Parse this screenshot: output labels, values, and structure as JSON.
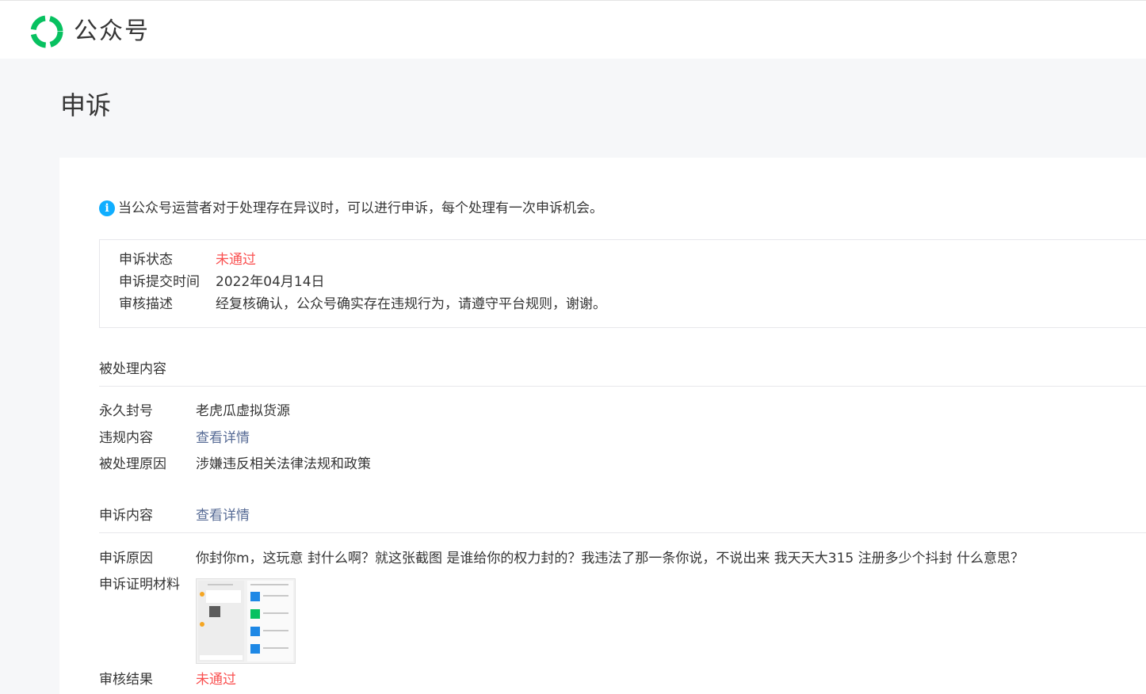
{
  "header": {
    "brand": "公众号",
    "colors": {
      "logo_green": "#07c160",
      "logo_dark_green": "#1aad19"
    }
  },
  "page": {
    "title": "申诉"
  },
  "notice": {
    "icon": "info-icon",
    "text": "当公众号运营者对于处理存在异议时，可以进行申诉，每个处理有一次申诉机会。"
  },
  "status_box": {
    "status_label": "申诉状态",
    "status_value": "未通过",
    "time_label": "申诉提交时间",
    "time_value": "2022年04月14日",
    "desc_label": "审核描述",
    "desc_value": "经复核确认，公众号确实存在违规行为，请遵守平台规则，谢谢。"
  },
  "processed": {
    "title": "被处理内容",
    "ban_label": "永久封号",
    "ban_value": "老虎瓜虚拟货源",
    "violation_label": "违规内容",
    "violation_link": "查看详情",
    "reason_label": "被处理原因",
    "reason_value": "涉嫌违反相关法律法规和政策"
  },
  "appeal": {
    "title": "申诉内容",
    "title_link": "查看详情",
    "reason_label": "申诉原因",
    "reason_value": "你封你m，这玩意 封什么啊？就这张截图  是谁给你的权力封的？我违法了那一条你说，不说出来 我天天大315  注册多少个抖封 什么意思？",
    "evidence_label": "申诉证明材料",
    "result_label": "审核结果",
    "result_value": "未通过"
  },
  "colors": {
    "red": "#fa5151",
    "link": "#576b95",
    "info_blue": "#10aeff",
    "text": "#353535"
  }
}
